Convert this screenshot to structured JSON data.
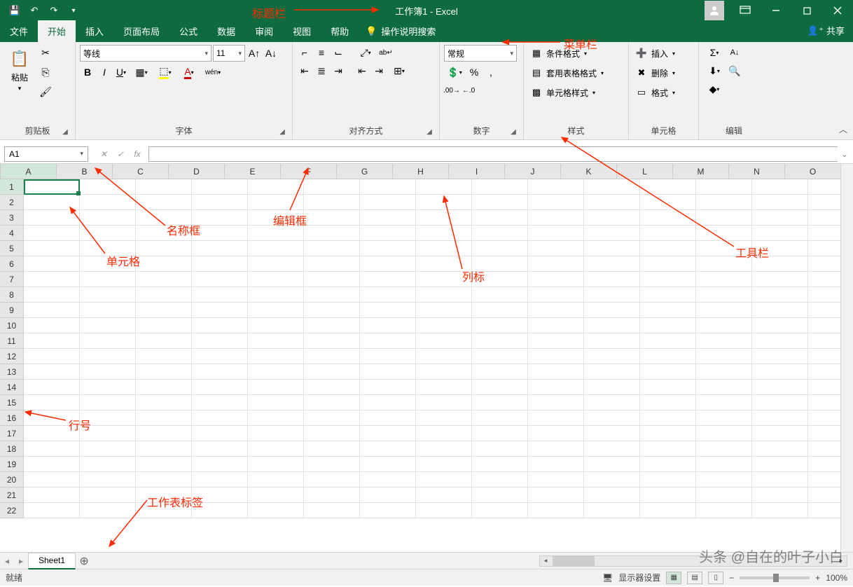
{
  "titlebar": {
    "title": "工作簿1 - Excel"
  },
  "menus": {
    "file": "文件",
    "home": "开始",
    "insert": "插入",
    "layout": "页面布局",
    "formulas": "公式",
    "data": "数据",
    "review": "审阅",
    "view": "视图",
    "help": "帮助",
    "tellme": "操作说明搜索",
    "share": "共享"
  },
  "ribbon": {
    "clipboard": {
      "label": "剪贴板",
      "paste": "粘贴"
    },
    "font": {
      "label": "字体",
      "name": "等线",
      "size": "11"
    },
    "align": {
      "label": "对齐方式"
    },
    "number": {
      "label": "数字",
      "format": "常规"
    },
    "styles": {
      "label": "样式",
      "cond": "条件格式",
      "table": "套用表格格式",
      "cell": "单元格样式"
    },
    "cells": {
      "label": "单元格",
      "insert": "插入",
      "delete": "删除",
      "format": "格式"
    },
    "editing": {
      "label": "编辑"
    }
  },
  "namebox": "A1",
  "columns": [
    "A",
    "B",
    "C",
    "D",
    "E",
    "F",
    "G",
    "H",
    "I",
    "J",
    "K",
    "L",
    "M",
    "N",
    "O"
  ],
  "rows": [
    "1",
    "2",
    "3",
    "4",
    "5",
    "6",
    "7",
    "8",
    "9",
    "10",
    "11",
    "12",
    "13",
    "14",
    "15",
    "16",
    "17",
    "18",
    "19",
    "20",
    "21",
    "22"
  ],
  "sheet": {
    "tab": "Sheet1"
  },
  "status": {
    "ready": "就绪",
    "display": "显示器设置",
    "zoom": "100%"
  },
  "annotations": {
    "titlebar": "标题栏",
    "menubar": "菜单栏",
    "toolbar": "工具栏",
    "namebox": "名称框",
    "editbox": "编辑框",
    "cell": "单元格",
    "colheader": "列标",
    "rowheader": "行号",
    "sheettab": "工作表标签"
  },
  "watermark": "头条 @自在的叶子小白"
}
